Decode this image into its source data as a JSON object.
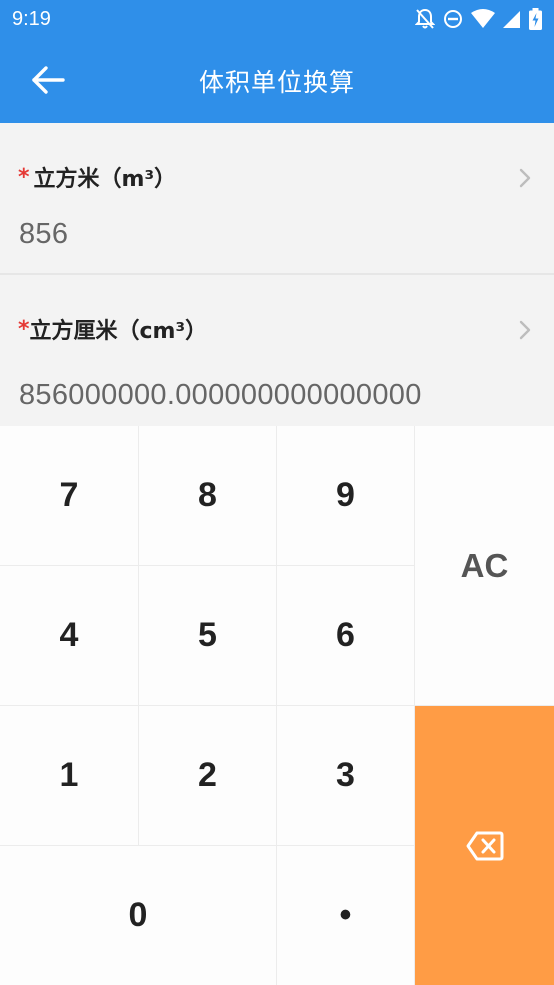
{
  "status_bar": {
    "time": "9:19",
    "icons": [
      "bell-off-icon",
      "do-not-disturb-icon",
      "wifi-icon",
      "signal-icon",
      "battery-charging-icon"
    ]
  },
  "app_bar": {
    "title": "体积单位换算",
    "back_icon": "arrow-left-icon"
  },
  "units": [
    {
      "required": "*",
      "label": "立方米（m³）",
      "value": "856"
    },
    {
      "required": "*",
      "label": "立方厘米（cm³）",
      "value": "856000000.000000000000000"
    }
  ],
  "keypad": {
    "keys": [
      "7",
      "8",
      "9",
      "4",
      "5",
      "6",
      "1",
      "2",
      "3",
      "0",
      "•"
    ],
    "clear_label": "AC",
    "backspace_icon": "backspace-icon",
    "backspace_color": "#ff9c45"
  },
  "colors": {
    "primary": "#2f8fe9",
    "required_star": "#e53935",
    "accent": "#ff9c45"
  }
}
